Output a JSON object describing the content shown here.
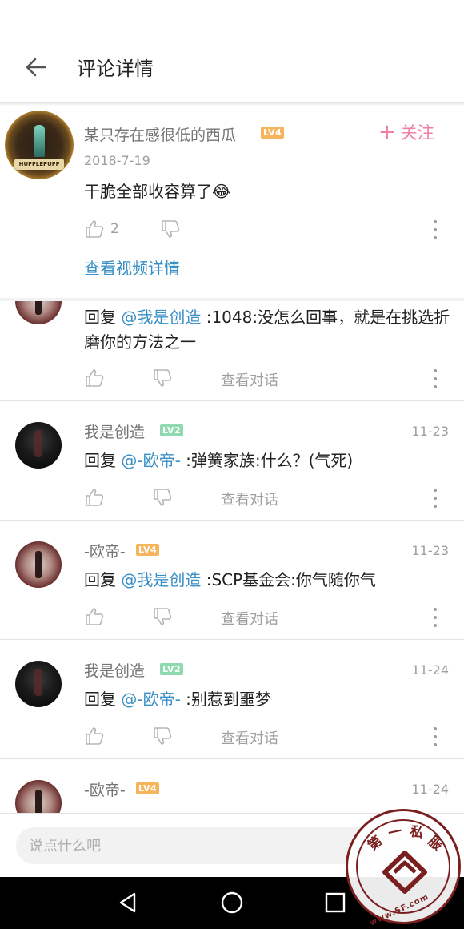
{
  "header": {
    "title": "评论详情"
  },
  "main_comment": {
    "username": "某只存在感很低的西瓜",
    "level": "LV4",
    "date": "2018-7-19",
    "text": "干脆全部收容算了😂",
    "like_count": "2",
    "follow_label": "关注",
    "follow_plus": "+",
    "video_link": "查看视频详情",
    "avatar_banner": "HUFFLEPUFF"
  },
  "replies": [
    {
      "reply_prefix": "回复 ",
      "mention": "@我是创造",
      "text": " :1048:没怎么回事，就是在挑选折磨你的方法之一",
      "view_convo": "查看对话"
    },
    {
      "username": "我是创造",
      "level": "LV2",
      "time": "11-23",
      "reply_prefix": "回复 ",
      "mention": "@-欧帝-",
      "text": " :弹簧家族:什么？(气死)",
      "view_convo": "查看对话"
    },
    {
      "username": "-欧帝-",
      "level": "LV4",
      "time": "11-23",
      "reply_prefix": "回复 ",
      "mention": "@我是创造",
      "text": " :SCP基金会:你气随你气",
      "view_convo": "查看对话"
    },
    {
      "username": "我是创造",
      "level": "LV2",
      "time": "11-24",
      "reply_prefix": "回复 ",
      "mention": "@-欧帝-",
      "text": " :别惹到噩梦",
      "view_convo": "查看对话"
    },
    {
      "username": "-欧帝-",
      "level": "LV4",
      "time": "11-24"
    }
  ],
  "input": {
    "placeholder": "说点什么吧"
  },
  "watermark": {
    "chars": [
      "第",
      "一",
      "私",
      "服"
    ],
    "url": "www.SF.com"
  },
  "colors": {
    "accent_blue": "#3a8fc6",
    "follow_pink": "#f07fa3",
    "lv4": "#f6b45b",
    "lv2": "#8fd9b0"
  }
}
